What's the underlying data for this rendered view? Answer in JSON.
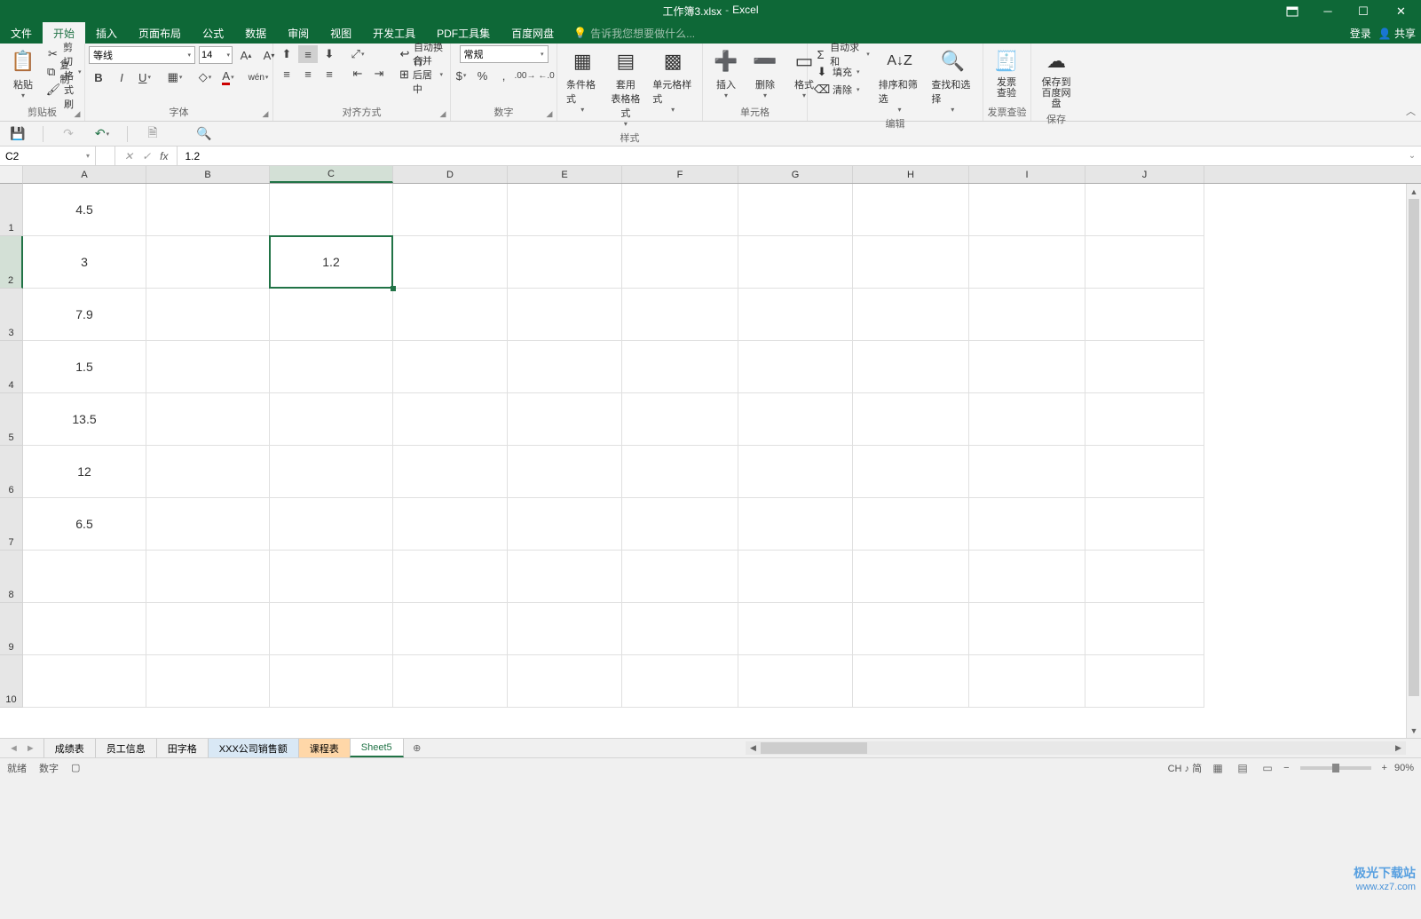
{
  "title": {
    "file": "工作簿3.xlsx",
    "app": "Excel"
  },
  "menu": {
    "file": "文件",
    "home": "开始",
    "insert": "插入",
    "layout": "页面布局",
    "formulas": "公式",
    "data": "数据",
    "review": "审阅",
    "view": "视图",
    "dev": "开发工具",
    "pdf": "PDF工具集",
    "baidu": "百度网盘",
    "tellme_placeholder": "告诉我您想要做什么...",
    "login": "登录",
    "share": "共享"
  },
  "ribbon": {
    "clipboard": {
      "paste": "粘贴",
      "cut": "剪切",
      "copy": "复制",
      "format_painter": "格式刷",
      "label": "剪贴板"
    },
    "font": {
      "name": "等线",
      "size": "14",
      "label": "字体"
    },
    "alignment": {
      "wrap": "自动换行",
      "merge": "合并后居中",
      "label": "对齐方式"
    },
    "number": {
      "format": "常规",
      "label": "数字"
    },
    "styles": {
      "cond": "条件格式",
      "table": "套用\n表格格式",
      "cell": "单元格样式",
      "label": "样式"
    },
    "cells": {
      "insert": "插入",
      "delete": "删除",
      "format": "格式",
      "label": "单元格"
    },
    "editing": {
      "autosum": "自动求和",
      "fill": "填充",
      "clear": "清除",
      "sort": "排序和筛选",
      "find": "查找和选择",
      "label": "编辑"
    },
    "invoice": {
      "invoice": "发票\n查验",
      "label": "发票查验"
    },
    "save": {
      "save": "保存到\n百度网盘",
      "label": "保存"
    }
  },
  "name_box": "C2",
  "formula": "1.2",
  "columns": [
    "A",
    "B",
    "C",
    "D",
    "E",
    "F",
    "G",
    "H",
    "I",
    "J"
  ],
  "rows": [
    "1",
    "2",
    "3",
    "4",
    "5",
    "6",
    "7",
    "8",
    "9",
    "10"
  ],
  "data": {
    "A1": "4.5",
    "A2": "3",
    "A3": "7.9",
    "A4": "1.5",
    "A5": "13.5",
    "A6": "12",
    "A7": "6.5",
    "C2": "1.2"
  },
  "active_cell": "C2",
  "sheets": {
    "s1": "成绩表",
    "s2": "员工信息",
    "s3": "田字格",
    "s4": "XXX公司销售额",
    "s5": "课程表",
    "s6": "Sheet5"
  },
  "status": {
    "ready": "就绪",
    "numlock": "数字",
    "ime": "CH ♪ 简",
    "zoom": "90%"
  },
  "watermark": {
    "name": "极光下载站",
    "url": "www.xz7.com"
  }
}
